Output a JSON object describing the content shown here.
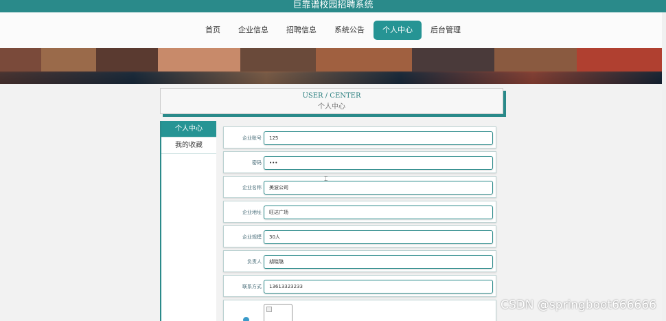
{
  "app": {
    "title": "巨靠谱校园招聘系统"
  },
  "nav": [
    {
      "label": "首页",
      "active": false
    },
    {
      "label": "企业信息",
      "active": false
    },
    {
      "label": "招聘信息",
      "active": false
    },
    {
      "label": "系统公告",
      "active": false
    },
    {
      "label": "个人中心",
      "active": true
    },
    {
      "label": "后台管理",
      "active": false
    }
  ],
  "center": {
    "en": "USER / CENTER",
    "cn": "个人中心"
  },
  "sidebar": [
    {
      "label": "个人中心",
      "active": true
    },
    {
      "label": "我的收藏",
      "active": false
    }
  ],
  "form": {
    "account": {
      "label": "企业账号",
      "value": "125"
    },
    "password": {
      "label": "密码",
      "value": "•••"
    },
    "company_name": {
      "label": "企业名称",
      "value": "美波公司"
    },
    "company_address": {
      "label": "企业地址",
      "value": "旺达广场"
    },
    "company_size": {
      "label": "企业规模",
      "value": "30人"
    },
    "contact_person": {
      "label": "负责人",
      "value": "胡晓璐"
    },
    "phone": {
      "label": "联系方式",
      "value": "13613323233"
    }
  },
  "watermark": "CSDN @springboot666666",
  "colors": {
    "accent": "#269494",
    "title_bar": "#2a8a8a"
  }
}
